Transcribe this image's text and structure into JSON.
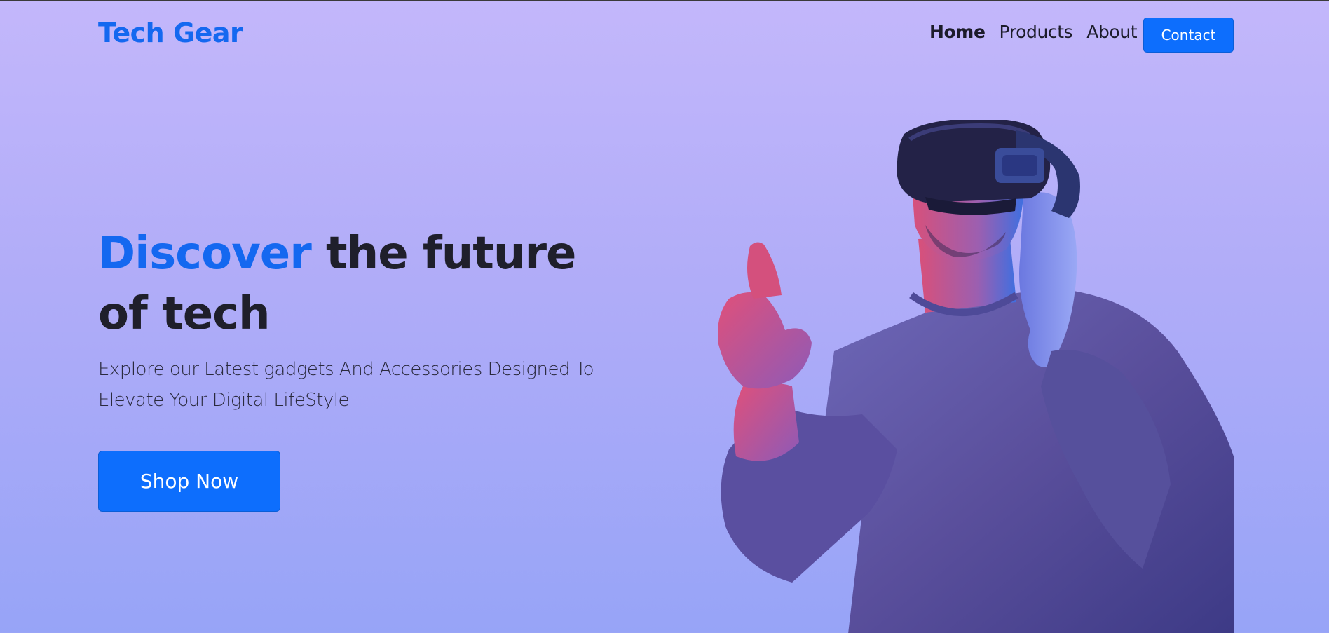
{
  "header": {
    "brand": "Tech Gear",
    "nav": [
      {
        "label": "Home",
        "active": true
      },
      {
        "label": "Products",
        "active": false
      },
      {
        "label": "About",
        "active": false
      }
    ],
    "contact_label": "Contact"
  },
  "hero": {
    "title_accent": "Discover",
    "title_rest": " the future of tech",
    "subtitle": "Explore our Latest gadgets And Accessories Designed To Elevate Your Digital LifeStyle",
    "cta_label": "Shop Now",
    "image_icon": "vr-headset-person-icon"
  },
  "colors": {
    "accent": "#1468f0",
    "button": "#0d6efd",
    "background_top": "#c3b7fb",
    "background_bottom": "#97a4f7"
  }
}
